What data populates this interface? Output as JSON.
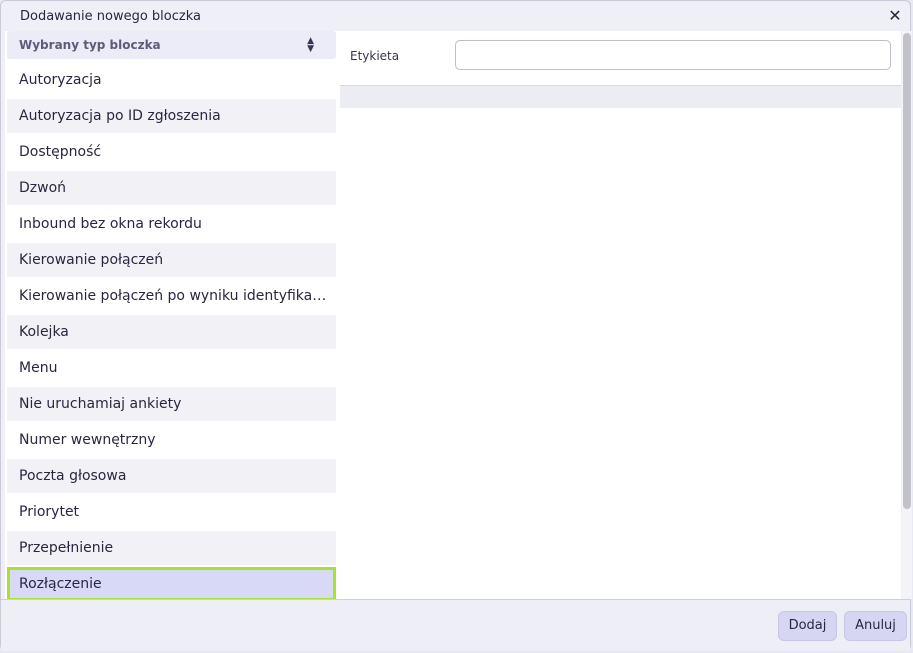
{
  "dialog": {
    "title": "Dodawanie nowego bloczka",
    "close_glyph": "✕"
  },
  "form": {
    "label": "Etykieta",
    "value": ""
  },
  "dropdown": {
    "header": "Wybrany typ bloczka",
    "sort_icon": "sort-icon",
    "options": [
      {
        "label": "Autoryzacja"
      },
      {
        "label": "Autoryzacja po ID zgłoszenia"
      },
      {
        "label": "Dostępność"
      },
      {
        "label": "Dzwoń"
      },
      {
        "label": "Inbound bez okna rekordu"
      },
      {
        "label": "Kierowanie połączeń"
      },
      {
        "label": "Kierowanie połączeń po wyniku identyfika…"
      },
      {
        "label": "Kolejka"
      },
      {
        "label": "Menu"
      },
      {
        "label": "Nie uruchamiaj ankiety"
      },
      {
        "label": "Numer wewnętrzny"
      },
      {
        "label": "Poczta głosowa"
      },
      {
        "label": "Priorytet"
      },
      {
        "label": "Przepełnienie"
      },
      {
        "label": "Rozłączenie"
      }
    ],
    "selected_index": 14
  },
  "footer": {
    "add_label": "Dodaj",
    "cancel_label": "Anuluj"
  },
  "colors": {
    "selection_outline": "#a6e22e",
    "selection_bg": "#d8d8f7",
    "button_bg": "#d6d6f3"
  }
}
